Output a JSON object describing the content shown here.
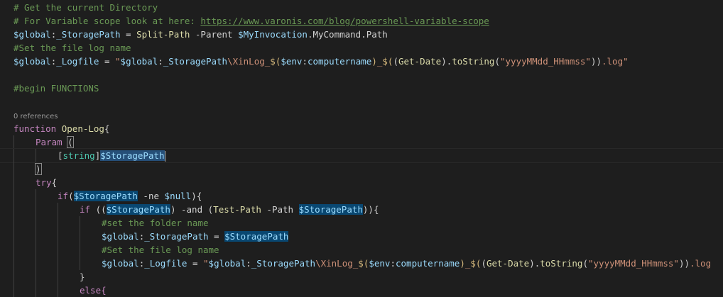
{
  "editor": {
    "lines": [
      {
        "indent": 0,
        "tokens": [
          {
            "t": "# Get the current Directory",
            "c": "cmt"
          }
        ]
      },
      {
        "indent": 0,
        "tokens": [
          {
            "t": "# For Variable scope look at here: ",
            "c": "cmt"
          },
          {
            "t": "https://www.varonis.com/blog/powershell-variable-scope",
            "c": "url"
          }
        ]
      },
      {
        "indent": 0,
        "tokens": [
          {
            "t": "$global",
            "c": "var"
          },
          {
            "t": ":",
            "c": "txt"
          },
          {
            "t": "_StoragePath",
            "c": "var"
          },
          {
            "t": " = ",
            "c": "txt"
          },
          {
            "t": "Split-Path",
            "c": "fn"
          },
          {
            "t": " -Parent ",
            "c": "txt"
          },
          {
            "t": "$MyInvocation",
            "c": "var"
          },
          {
            "t": ".MyCommand.Path",
            "c": "txt"
          }
        ]
      },
      {
        "indent": 0,
        "tokens": [
          {
            "t": "#Set the file log name",
            "c": "cmt"
          }
        ]
      },
      {
        "indent": 0,
        "tokens": [
          {
            "t": "$global",
            "c": "var"
          },
          {
            "t": ":",
            "c": "txt"
          },
          {
            "t": "_Logfile",
            "c": "var"
          },
          {
            "t": " = ",
            "c": "txt"
          },
          {
            "t": "\"",
            "c": "str"
          },
          {
            "t": "$global",
            "c": "var"
          },
          {
            "t": ":",
            "c": "txt"
          },
          {
            "t": "_StoragePath",
            "c": "var"
          },
          {
            "t": "\\XinLog_",
            "c": "str"
          },
          {
            "t": "$(",
            "c": "esc"
          },
          {
            "t": "$env",
            "c": "var"
          },
          {
            "t": ":",
            "c": "txt"
          },
          {
            "t": "computername",
            "c": "var"
          },
          {
            "t": ")",
            "c": "esc"
          },
          {
            "t": "_",
            "c": "str"
          },
          {
            "t": "$(",
            "c": "esc"
          },
          {
            "t": "(",
            "c": "txt"
          },
          {
            "t": "Get-Date",
            "c": "fn"
          },
          {
            "t": ").",
            "c": "txt"
          },
          {
            "t": "toString",
            "c": "fn"
          },
          {
            "t": "(",
            "c": "txt"
          },
          {
            "t": "\"yyyyMMdd_HHmmss\"",
            "c": "str"
          },
          {
            "t": "))",
            "c": "txt"
          },
          {
            "t": ".log\"",
            "c": "str"
          }
        ]
      },
      {
        "indent": 0,
        "tokens": []
      },
      {
        "indent": 0,
        "tokens": [
          {
            "t": "#begin FUNCTIONS",
            "c": "cmt"
          }
        ]
      },
      {
        "indent": 0,
        "tokens": []
      },
      {
        "indent": 0,
        "codelens": true,
        "tokens": [
          {
            "t": "0 references",
            "c": "codelens"
          }
        ]
      },
      {
        "indent": 0,
        "tokens": [
          {
            "t": "function",
            "c": "kw"
          },
          {
            "t": " ",
            "c": "txt"
          },
          {
            "t": "Open-Log",
            "c": "fn"
          },
          {
            "t": "{",
            "c": "txt"
          }
        ]
      },
      {
        "indent": 1,
        "tokens": [
          {
            "t": "Param",
            "c": "kw"
          },
          {
            "t": " ",
            "c": "txt"
          },
          {
            "t": "(",
            "c": "txt bracket"
          }
        ]
      },
      {
        "indent": 2,
        "active": true,
        "tokens": [
          {
            "t": "[",
            "c": "txt"
          },
          {
            "t": "string",
            "c": "type"
          },
          {
            "t": "]",
            "c": "txt"
          },
          {
            "t": "$StoragePath",
            "c": "var hl"
          },
          {
            "t": "|",
            "c": "cursor"
          }
        ]
      },
      {
        "indent": 1,
        "tokens": [
          {
            "t": ")",
            "c": "txt bracket"
          }
        ]
      },
      {
        "indent": 1,
        "tokens": [
          {
            "t": "try",
            "c": "kw"
          },
          {
            "t": "{",
            "c": "txt"
          }
        ]
      },
      {
        "indent": 2,
        "tokens": [
          {
            "t": "if",
            "c": "kw"
          },
          {
            "t": "(",
            "c": "txt"
          },
          {
            "t": "$StoragePath",
            "c": "var hl2"
          },
          {
            "t": " -ne ",
            "c": "txt"
          },
          {
            "t": "$null",
            "c": "var"
          },
          {
            "t": "){",
            "c": "txt"
          }
        ]
      },
      {
        "indent": 3,
        "tokens": [
          {
            "t": "if",
            "c": "kw"
          },
          {
            "t": " ((",
            "c": "txt"
          },
          {
            "t": "$StoragePath",
            "c": "var hl2"
          },
          {
            "t": ") -and (",
            "c": "txt"
          },
          {
            "t": "Test-Path",
            "c": "fn"
          },
          {
            "t": " -Path ",
            "c": "txt"
          },
          {
            "t": "$StoragePath",
            "c": "var hl2"
          },
          {
            "t": ")){",
            "c": "txt"
          }
        ]
      },
      {
        "indent": 4,
        "tokens": [
          {
            "t": "#set the folder name",
            "c": "cmt"
          }
        ]
      },
      {
        "indent": 4,
        "tokens": [
          {
            "t": "$global",
            "c": "var"
          },
          {
            "t": ":",
            "c": "txt"
          },
          {
            "t": "_StoragePath",
            "c": "var"
          },
          {
            "t": " = ",
            "c": "txt"
          },
          {
            "t": "$StoragePath",
            "c": "var hl2"
          }
        ]
      },
      {
        "indent": 4,
        "tokens": [
          {
            "t": "#Set the file log name",
            "c": "cmt"
          }
        ]
      },
      {
        "indent": 4,
        "tokens": [
          {
            "t": "$global",
            "c": "var"
          },
          {
            "t": ":",
            "c": "txt"
          },
          {
            "t": "_Logfile",
            "c": "var"
          },
          {
            "t": " = ",
            "c": "txt"
          },
          {
            "t": "\"",
            "c": "str"
          },
          {
            "t": "$global",
            "c": "var"
          },
          {
            "t": ":",
            "c": "txt"
          },
          {
            "t": "_StoragePath",
            "c": "var"
          },
          {
            "t": "\\XinLog_",
            "c": "str"
          },
          {
            "t": "$(",
            "c": "esc"
          },
          {
            "t": "$env",
            "c": "var"
          },
          {
            "t": ":",
            "c": "txt"
          },
          {
            "t": "computername",
            "c": "var"
          },
          {
            "t": ")",
            "c": "esc"
          },
          {
            "t": "_",
            "c": "str"
          },
          {
            "t": "$(",
            "c": "esc"
          },
          {
            "t": "(",
            "c": "txt"
          },
          {
            "t": "Get-Date",
            "c": "fn"
          },
          {
            "t": ").",
            "c": "txt"
          },
          {
            "t": "toString",
            "c": "fn"
          },
          {
            "t": "(",
            "c": "txt"
          },
          {
            "t": "\"yyyyMMdd_HHmmss\"",
            "c": "str"
          },
          {
            "t": "))",
            "c": "txt"
          },
          {
            "t": ".log",
            "c": "str"
          }
        ]
      },
      {
        "indent": 3,
        "tokens": [
          {
            "t": "}",
            "c": "txt"
          }
        ]
      },
      {
        "indent": 3,
        "tokens": [
          {
            "t": "else{",
            "c": "kw"
          }
        ]
      }
    ]
  }
}
